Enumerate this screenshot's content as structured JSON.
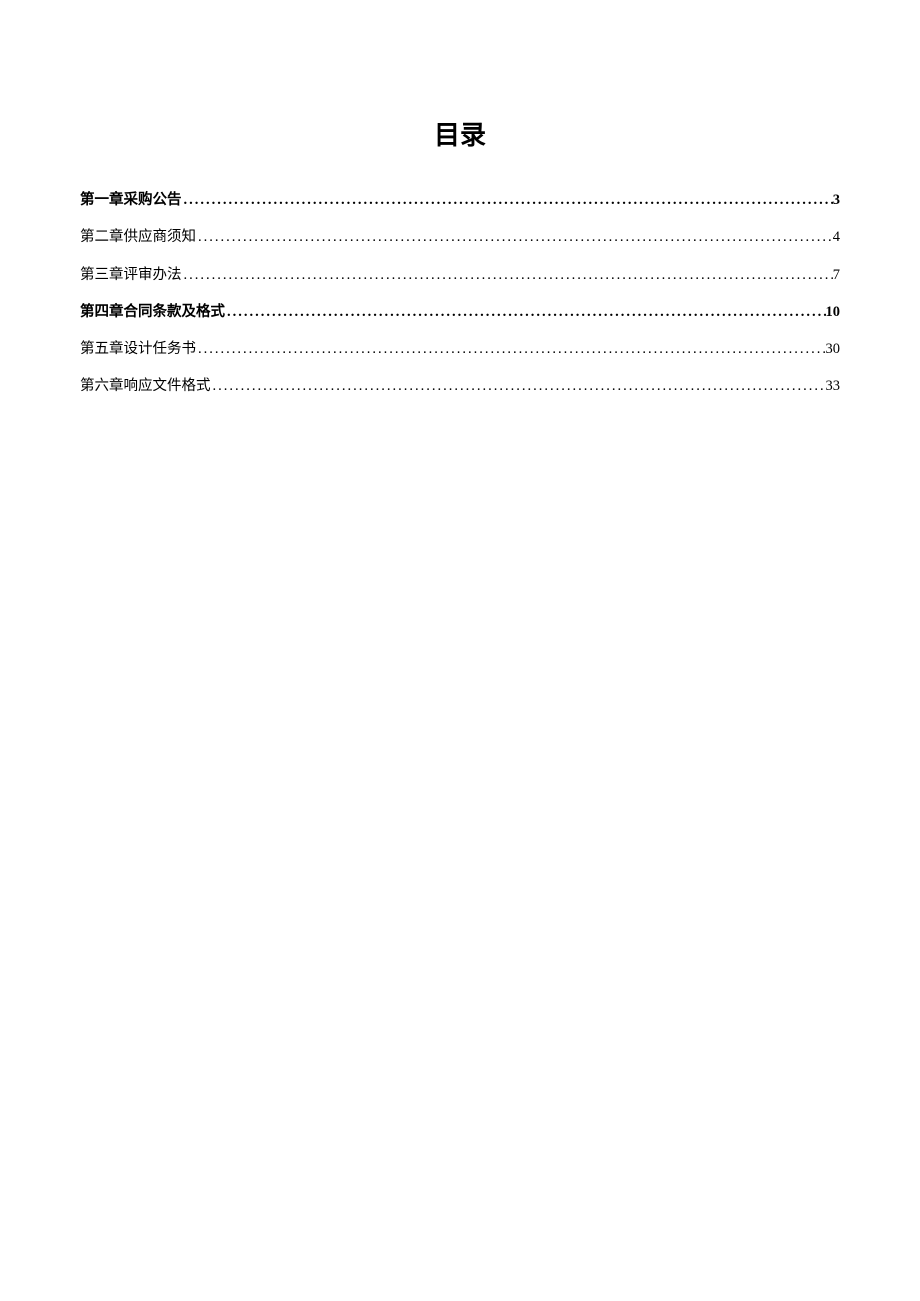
{
  "title": "目录",
  "toc": {
    "entries": [
      {
        "label": "第一章采购公告",
        "page": "3",
        "bold": true
      },
      {
        "label": "第二章供应商须知",
        "page": "4",
        "bold": false
      },
      {
        "label": "第三章评审办法",
        "page": "7",
        "bold": false
      },
      {
        "label": "第四章合同条款及格式",
        "page": "10",
        "bold": true
      },
      {
        "label": "第五章设计任务书",
        "page": "30",
        "bold": false
      },
      {
        "label": "第六章响应文件格式",
        "page": "33",
        "bold": false
      }
    ]
  }
}
